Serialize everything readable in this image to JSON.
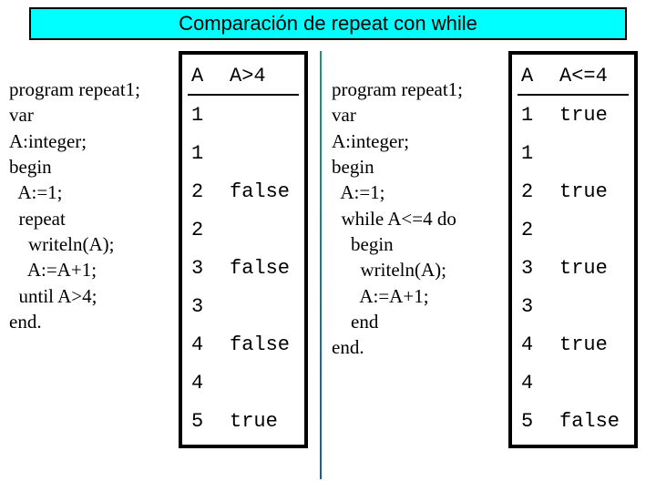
{
  "title": "Comparación de repeat con while",
  "left": {
    "code": "program repeat1;\nvar\nA:integer;\nbegin\n  A:=1;\n  repeat\n    writeln(A);\n    A:=A+1;\n  until A>4;\nend.",
    "headers": {
      "c1": "A",
      "c2": "A>4"
    },
    "rows": [
      {
        "a": "1",
        "r": ""
      },
      {
        "a": "1",
        "r": ""
      },
      {
        "a": "2",
        "r": "false"
      },
      {
        "a": "2",
        "r": ""
      },
      {
        "a": "3",
        "r": "false"
      },
      {
        "a": "3",
        "r": ""
      },
      {
        "a": "4",
        "r": "false"
      },
      {
        "a": "4",
        "r": ""
      },
      {
        "a": "5",
        "r": "true"
      }
    ]
  },
  "right": {
    "code": "program repeat1;\nvar\nA:integer;\nbegin\n  A:=1;\n  while A<=4 do\n    begin\n      writeln(A);\n      A:=A+1;\n    end\nend.",
    "headers": {
      "c1": "A",
      "c2": "A<=4"
    },
    "rows": [
      {
        "a": "1",
        "r": "true"
      },
      {
        "a": "1",
        "r": ""
      },
      {
        "a": "2",
        "r": "true"
      },
      {
        "a": "2",
        "r": ""
      },
      {
        "a": "3",
        "r": "true"
      },
      {
        "a": "3",
        "r": ""
      },
      {
        "a": "4",
        "r": "true"
      },
      {
        "a": "4",
        "r": ""
      },
      {
        "a": "5",
        "r": "false"
      }
    ]
  }
}
